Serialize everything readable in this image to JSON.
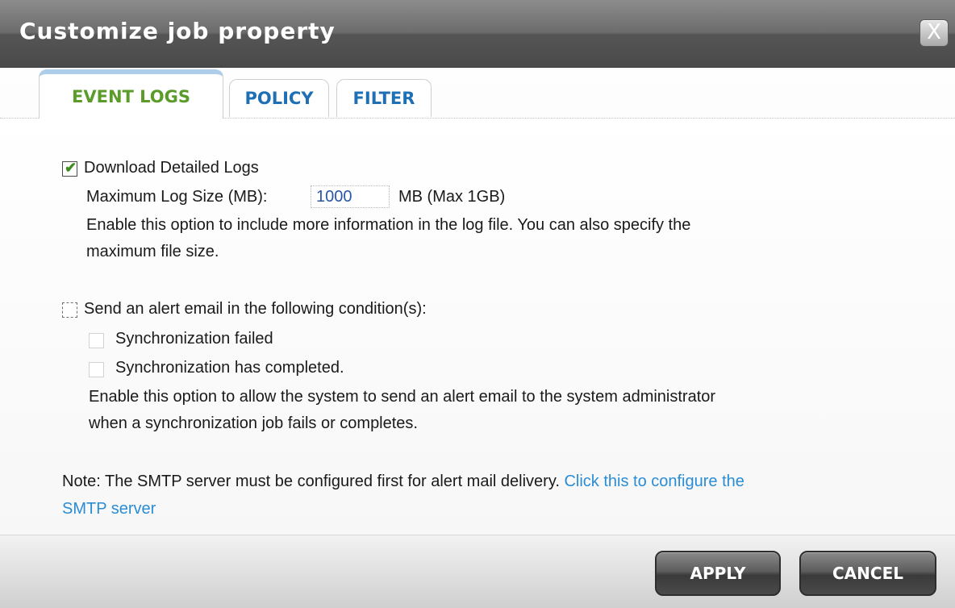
{
  "dialog": {
    "title": "Customize job property",
    "close_label": "X"
  },
  "tabs": [
    {
      "label": "EVENT LOGS",
      "active": true
    },
    {
      "label": "POLICY",
      "active": false
    },
    {
      "label": "FILTER",
      "active": false
    }
  ],
  "detailed_logs": {
    "checkbox_label": "Download Detailed Logs",
    "checked": true,
    "check_glyph": "✔",
    "max_size_label": "Maximum Log Size (MB):",
    "max_size_value": "1000",
    "max_size_unit": "MB (Max 1GB)",
    "description_line1": "Enable this option to include more information in the log file. You can also specify the",
    "description_line2": "maximum file size."
  },
  "alert_email": {
    "checkbox_label": "Send an alert email in the following condition(s):",
    "checked": false,
    "conditions": [
      {
        "label": "Synchronization failed",
        "checked": false
      },
      {
        "label": "Synchronization has completed.",
        "checked": false
      }
    ],
    "description_line1": "Enable this option to allow the system to send an alert email to the system administrator",
    "description_line2": "when a synchronization job fails or completes."
  },
  "note": {
    "text": "Note: The SMTP server must be configured first for alert mail delivery. ",
    "link_part1": "Click this to configure the",
    "link_part2": "SMTP server"
  },
  "footer": {
    "apply_label": "APPLY",
    "cancel_label": "CANCEL"
  },
  "colors": {
    "active_tab_text": "#5a9b2a",
    "inactive_tab_text": "#1e6fb4",
    "link": "#2a8dd4",
    "title_bar": "#6c6c6c"
  }
}
